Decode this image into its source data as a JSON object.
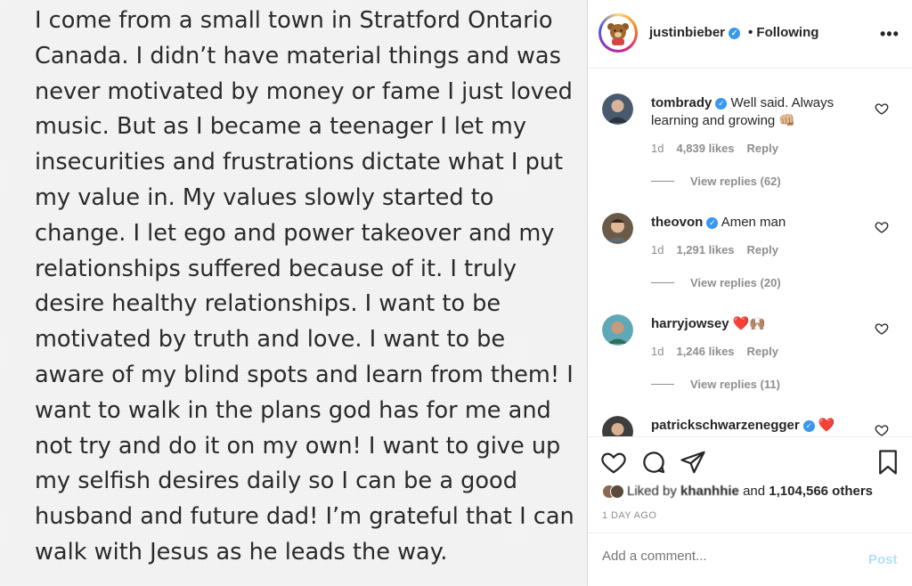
{
  "post": {
    "text_lines": [
      "I come from a small town in Stratford Ontario",
      "Canada. I didn’t have material things and was",
      "never motivated by money or fame I just loved",
      "music. But as I became a teenager I let my",
      "insecurities and frustrations dictate what I put",
      "my value in. My values slowly started to",
      "change. I let ego and power takeover and my",
      "relationships suffered because of it.  I truly",
      "desire healthy relationships. I want to be",
      "motivated by truth and love. I want to be",
      "aware of my blind spots and learn from them! I",
      "want to walk in the plans god has for me and",
      "not try and do it on my own! I want to give up",
      "my selfish desires daily so I can be a good",
      "husband and future dad! I’m grateful that I can",
      "walk with Jesus as he leads the way."
    ]
  },
  "header": {
    "username": "justinbieber",
    "following_label": "• Following",
    "more_label": "•••"
  },
  "comments": [
    {
      "username": "tombrady",
      "text": "Well said. Always learning and growing 👊🏼",
      "age": "1d",
      "likes": "4,839 likes",
      "reply": "Reply",
      "view_replies": "View replies (62)"
    },
    {
      "username": "theovon",
      "text": "Amen man",
      "age": "1d",
      "likes": "1,291 likes",
      "reply": "Reply",
      "view_replies": "View replies (20)"
    },
    {
      "username": "harryjowsey",
      "text": "❤️🙌🏽",
      "age": "1d",
      "likes": "1,246 likes",
      "reply": "Reply",
      "view_replies": "View replies (11)"
    },
    {
      "username": "patrickschwarzenegger",
      "text": "❤️"
    }
  ],
  "footer": {
    "liked_by_prefix": "Liked by",
    "liked_by_user": "khanhhie",
    "liked_by_suffix": " and ",
    "liked_count": "1,104,566 others",
    "time_ago": "1 DAY AGO",
    "comment_placeholder": "Add a comment...",
    "post_label": "Post"
  },
  "colors": {
    "accent": "#3897f0",
    "post_button": "#b2dffc",
    "heart_red": "#ed4956"
  }
}
